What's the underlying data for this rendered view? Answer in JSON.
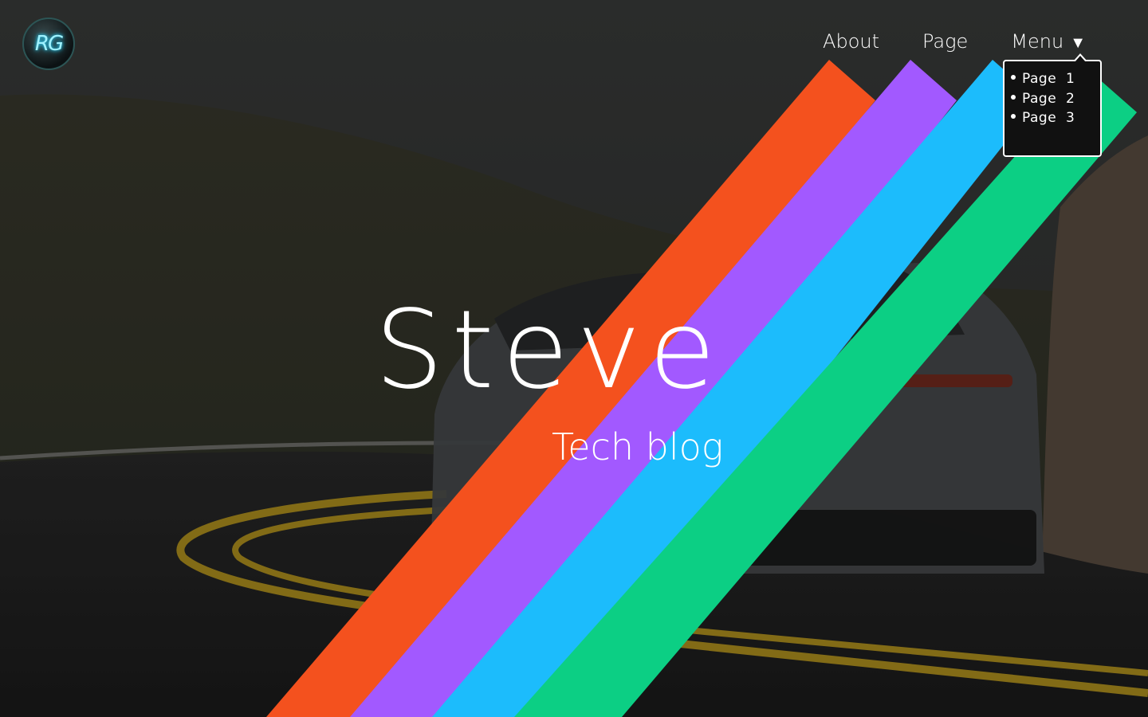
{
  "background": {
    "overlay_color": "#1f201f"
  },
  "logo": {
    "text": "RG",
    "glow_color": "#2ad6ff"
  },
  "nav": {
    "items": [
      {
        "label": "About"
      },
      {
        "label": "Page"
      },
      {
        "label": "Menu"
      }
    ],
    "menu_caret": "▼",
    "dropdown": {
      "items": [
        {
          "label": "Page  1"
        },
        {
          "label": "Page  2"
        },
        {
          "label": "Page  3"
        }
      ]
    }
  },
  "hero": {
    "title": "Steve",
    "subtitle": "Tech blog"
  },
  "stripes": {
    "colors": [
      "#f4511e",
      "#a259ff",
      "#1cbcfc",
      "#0ccf84"
    ]
  }
}
